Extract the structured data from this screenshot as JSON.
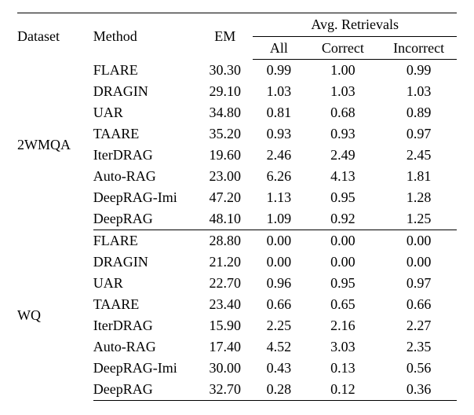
{
  "headers": {
    "dataset": "Dataset",
    "method": "Method",
    "em": "EM",
    "avg": "Avg. Retrievals",
    "all": "All",
    "correct": "Correct",
    "incorrect": "Incorrect"
  },
  "groups": [
    {
      "dataset": "2WMQA",
      "rows": [
        {
          "method": "FLARE",
          "em": "30.30",
          "all": "0.99",
          "correct": "1.00",
          "incorrect": "0.99"
        },
        {
          "method": "DRAGIN",
          "em": "29.10",
          "all": "1.03",
          "correct": "1.03",
          "incorrect": "1.03"
        },
        {
          "method": "UAR",
          "em": "34.80",
          "all": "0.81",
          "correct": "0.68",
          "incorrect": "0.89"
        },
        {
          "method": "TAARE",
          "em": "35.20",
          "all": "0.93",
          "correct": "0.93",
          "incorrect": "0.97"
        },
        {
          "method": "IterDRAG",
          "em": "19.60",
          "all": "2.46",
          "correct": "2.49",
          "incorrect": "2.45"
        },
        {
          "method": "Auto-RAG",
          "em": "23.00",
          "all": "6.26",
          "correct": "4.13",
          "incorrect": "1.81"
        },
        {
          "method": "DeepRAG-Imi",
          "em": "47.20",
          "all": "1.13",
          "correct": "0.95",
          "incorrect": "1.28"
        },
        {
          "method": "DeepRAG",
          "em": "48.10",
          "all": "1.09",
          "correct": "0.92",
          "incorrect": "1.25"
        }
      ]
    },
    {
      "dataset": "WQ",
      "rows": [
        {
          "method": "FLARE",
          "em": "28.80",
          "all": "0.00",
          "correct": "0.00",
          "incorrect": "0.00"
        },
        {
          "method": "DRAGIN",
          "em": "21.20",
          "all": "0.00",
          "correct": "0.00",
          "incorrect": "0.00"
        },
        {
          "method": "UAR",
          "em": "22.70",
          "all": "0.96",
          "correct": "0.95",
          "incorrect": "0.97"
        },
        {
          "method": "TAARE",
          "em": "23.40",
          "all": "0.66",
          "correct": "0.65",
          "incorrect": "0.66"
        },
        {
          "method": "IterDRAG",
          "em": "15.90",
          "all": "2.25",
          "correct": "2.16",
          "incorrect": "2.27"
        },
        {
          "method": "Auto-RAG",
          "em": "17.40",
          "all": "4.52",
          "correct": "3.03",
          "incorrect": "2.35"
        },
        {
          "method": "DeepRAG-Imi",
          "em": "30.00",
          "all": "0.43",
          "correct": "0.13",
          "incorrect": "0.56"
        },
        {
          "method": "DeepRAG",
          "em": "32.70",
          "all": "0.28",
          "correct": "0.12",
          "incorrect": "0.36"
        }
      ]
    }
  ],
  "chart_data": {
    "type": "table",
    "title": "",
    "columns": [
      "Dataset",
      "Method",
      "EM",
      "Avg. Retrievals All",
      "Avg. Retrievals Correct",
      "Avg. Retrievals Incorrect"
    ],
    "rows": [
      [
        "2WMQA",
        "FLARE",
        30.3,
        0.99,
        1.0,
        0.99
      ],
      [
        "2WMQA",
        "DRAGIN",
        29.1,
        1.03,
        1.03,
        1.03
      ],
      [
        "2WMQA",
        "UAR",
        34.8,
        0.81,
        0.68,
        0.89
      ],
      [
        "2WMQA",
        "TAARE",
        35.2,
        0.93,
        0.93,
        0.97
      ],
      [
        "2WMQA",
        "IterDRAG",
        19.6,
        2.46,
        2.49,
        2.45
      ],
      [
        "2WMQA",
        "Auto-RAG",
        23.0,
        6.26,
        4.13,
        1.81
      ],
      [
        "2WMQA",
        "DeepRAG-Imi",
        47.2,
        1.13,
        0.95,
        1.28
      ],
      [
        "2WMQA",
        "DeepRAG",
        48.1,
        1.09,
        0.92,
        1.25
      ],
      [
        "WQ",
        "FLARE",
        28.8,
        0.0,
        0.0,
        0.0
      ],
      [
        "WQ",
        "DRAGIN",
        21.2,
        0.0,
        0.0,
        0.0
      ],
      [
        "WQ",
        "UAR",
        22.7,
        0.96,
        0.95,
        0.97
      ],
      [
        "WQ",
        "TAARE",
        23.4,
        0.66,
        0.65,
        0.66
      ],
      [
        "WQ",
        "IterDRAG",
        15.9,
        2.25,
        2.16,
        2.27
      ],
      [
        "WQ",
        "Auto-RAG",
        17.4,
        4.52,
        3.03,
        2.35
      ],
      [
        "WQ",
        "DeepRAG-Imi",
        30.0,
        0.43,
        0.13,
        0.56
      ],
      [
        "WQ",
        "DeepRAG",
        32.7,
        0.28,
        0.12,
        0.36
      ]
    ]
  }
}
